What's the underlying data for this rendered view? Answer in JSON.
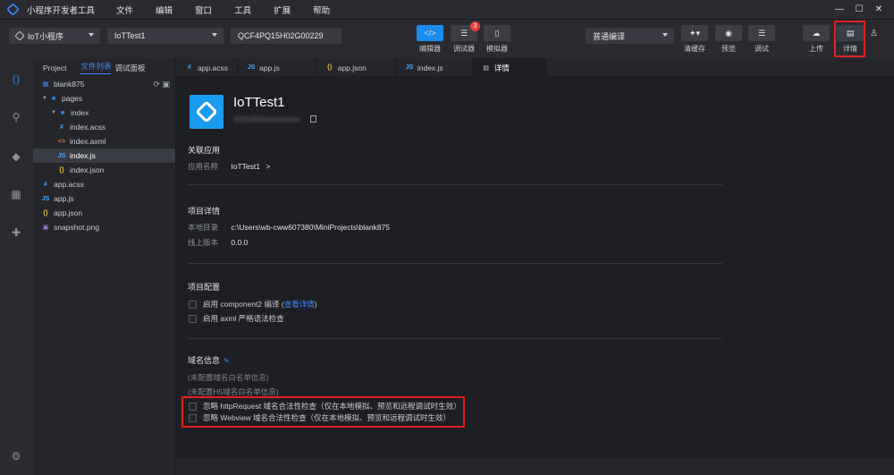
{
  "titlebar": {
    "app_name": "小程序开发者工具",
    "menu": [
      "文件",
      "编辑",
      "窗口",
      "工具",
      "扩展",
      "帮助"
    ],
    "controls": [
      "—",
      "☐",
      "✕"
    ]
  },
  "toolbar": {
    "platform": "IoT小程序",
    "project": "IoTTest1",
    "device_id": "QCF4PQ15H02G00229",
    "buttons": [
      {
        "label": "编辑器",
        "icon": "code-icon"
      },
      {
        "label": "调试器",
        "icon": "sliders-icon",
        "badge": "3"
      },
      {
        "label": "模拟器",
        "icon": "phone-icon"
      }
    ],
    "compile_mode": "普通编译",
    "right_buttons": [
      {
        "label": "清缓存",
        "icon": "broom-icon"
      },
      {
        "label": "预览",
        "icon": "eye-icon"
      },
      {
        "label": "调试",
        "icon": "sliders-icon"
      },
      {
        "label": "上传",
        "icon": "cloud-upload-icon"
      },
      {
        "label": "详情",
        "icon": "document-icon"
      }
    ]
  },
  "filepanel": {
    "tabs": [
      "Project",
      "文件列表",
      "调试面板"
    ],
    "root": "blank875",
    "tree": [
      {
        "name": "pages",
        "type": "folder",
        "level": 1
      },
      {
        "name": "index",
        "type": "folder",
        "level": 2
      },
      {
        "name": "index.acss",
        "type": "acss",
        "level": 3
      },
      {
        "name": "index.axml",
        "type": "axml",
        "level": 3
      },
      {
        "name": "index.js",
        "type": "js",
        "level": 3,
        "selected": true
      },
      {
        "name": "index.json",
        "type": "json",
        "level": 3
      },
      {
        "name": "app.acss",
        "type": "acss",
        "level": 1
      },
      {
        "name": "app.js",
        "type": "js",
        "level": 1
      },
      {
        "name": "app.json",
        "type": "json",
        "level": 1
      },
      {
        "name": "snapshot.png",
        "type": "png",
        "level": 1
      }
    ]
  },
  "editor_tabs": [
    {
      "name": "app.acss",
      "type": "acss"
    },
    {
      "name": "app.js",
      "type": "js"
    },
    {
      "name": "app.json",
      "type": "json"
    },
    {
      "name": "index.js",
      "type": "js"
    },
    {
      "name": "详情",
      "type": "doc",
      "active": true
    }
  ],
  "details": {
    "project_name": "IoTTest1",
    "project_id": "2021002xxxxxxxxx",
    "assoc_app": {
      "title": "关联应用",
      "app_name_key": "应用名称",
      "app_name_val": "IoTTest1",
      "arrow": ">"
    },
    "project_info": {
      "title": "项目详情",
      "local_dir_key": "本地目录",
      "local_dir_val": "c:\\Users\\wb-cww607380\\MiniProjects\\blank875",
      "online_ver_key": "线上版本",
      "online_ver_val": "0.0.0"
    },
    "project_config": {
      "title": "项目配置",
      "opt1_prefix": "启用 component2 编译 (",
      "opt1_link": "查看详情",
      "opt1_suffix": ")",
      "opt2": "启用 axml 严格语法检查"
    },
    "domain": {
      "title": "域名信息",
      "whitelist": "(未配置域名白名单信息)",
      "h5_whitelist": "(未配置H5域名白名单信息)",
      "ignore_http": "忽略 httpRequest 域名合法性检查（仅在本地模拟、预览和远程调试时生效）",
      "ignore_webview": "忽略 Webview 域名合法性检查（仅在本地模拟、预览和远程调试时生效）"
    }
  },
  "colors": {
    "accent": "#1a8cf0",
    "highlight": "#e0201f",
    "background": "#1e1f24"
  }
}
